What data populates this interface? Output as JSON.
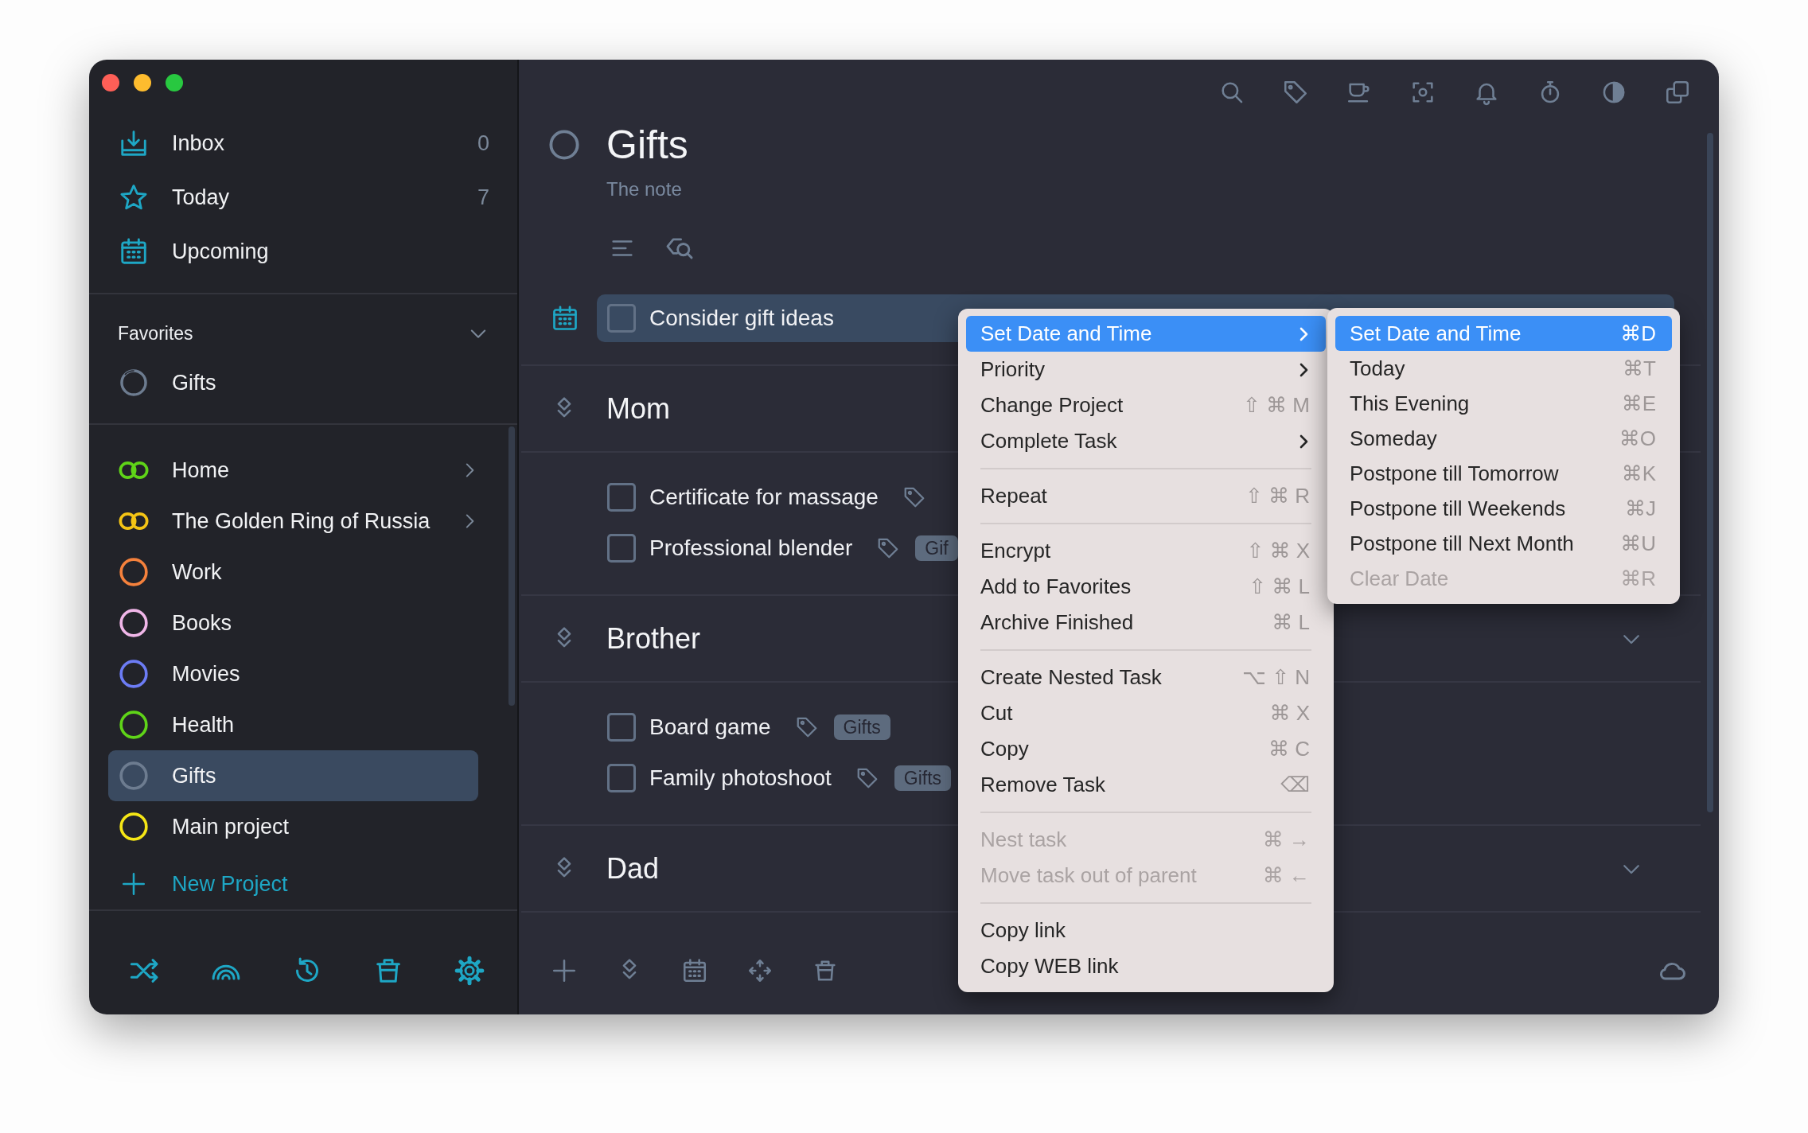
{
  "sidebar": {
    "nav": [
      {
        "kind": "inbox",
        "label": "Inbox",
        "count": "0"
      },
      {
        "kind": "today",
        "label": "Today",
        "count": "7"
      },
      {
        "kind": "upcoming",
        "label": "Upcoming"
      }
    ],
    "favorites": {
      "title": "Favorites",
      "expanded": true,
      "items": [
        {
          "label": "Gifts"
        }
      ]
    },
    "projects": [
      {
        "kind": "area",
        "label": "Home",
        "color": "#5fd418",
        "selected": false
      },
      {
        "kind": "area",
        "label": "The Golden Ring of Russia",
        "color": "#f4c415",
        "selected": false
      },
      {
        "kind": "project",
        "label": "Work",
        "color": "#f5813c",
        "selected": false
      },
      {
        "kind": "project",
        "label": "Books",
        "color": "#f0b6e8",
        "selected": false
      },
      {
        "kind": "project",
        "label": "Movies",
        "color": "#6c7cf5",
        "selected": false
      },
      {
        "kind": "project",
        "label": "Health",
        "color": "#5fd418",
        "selected": false
      },
      {
        "kind": "project",
        "label": "Gifts",
        "color": "#6d7c90",
        "selected": true
      },
      {
        "kind": "project",
        "label": "Main project",
        "color": "#f5e616",
        "selected": false
      }
    ],
    "new_project": "New Project"
  },
  "project": {
    "title": "Gifts",
    "note": "The note"
  },
  "tasks": [
    {
      "title": "Consider gift ideas",
      "checked": false,
      "selected": true,
      "tag_icon": false
    }
  ],
  "sections": [
    {
      "title": "Mom",
      "tasks": [
        {
          "title": "Certificate for massage",
          "checked": false,
          "tag_icon": true
        },
        {
          "title": "Professional blender",
          "checked": false,
          "tag_icon": true,
          "tag": "Gif"
        }
      ]
    },
    {
      "title": "Brother",
      "expanded": true,
      "tasks": [
        {
          "title": "Board game",
          "checked": false,
          "tag_icon": true,
          "tag": "Gifts"
        },
        {
          "title": "Family photoshoot",
          "checked": false,
          "tag_icon": true,
          "tag": "Gifts"
        }
      ]
    },
    {
      "title": "Dad",
      "expanded": true
    }
  ],
  "context_menu": {
    "groups": [
      [
        {
          "label": "Set Date and Time",
          "submenu": true,
          "selected": true,
          "disabled": false
        },
        {
          "label": "Priority",
          "submenu": true,
          "selected": false,
          "disabled": false
        },
        {
          "label": "Change Project",
          "shortcut": "⇧ ⌘ M",
          "submenu": false,
          "selected": false,
          "disabled": false
        },
        {
          "label": "Complete Task",
          "submenu": true,
          "selected": false,
          "disabled": false
        }
      ],
      [
        {
          "label": "Repeat",
          "shortcut": "⇧ ⌘ R",
          "submenu": false,
          "selected": false,
          "disabled": false
        }
      ],
      [
        {
          "label": "Encrypt",
          "shortcut": "⇧ ⌘ X",
          "submenu": false,
          "selected": false,
          "disabled": false
        },
        {
          "label": "Add to Favorites",
          "shortcut": "⇧ ⌘ L",
          "submenu": false,
          "selected": false,
          "disabled": false
        },
        {
          "label": "Archive Finished",
          "shortcut": "⌘ L",
          "submenu": false,
          "selected": false,
          "disabled": false
        }
      ],
      [
        {
          "label": "Create Nested Task",
          "shortcut": "⌥ ⇧ N",
          "submenu": false,
          "selected": false,
          "disabled": false
        },
        {
          "label": "Cut",
          "shortcut": "⌘ X",
          "submenu": false,
          "selected": false,
          "disabled": false
        },
        {
          "label": "Copy",
          "shortcut": "⌘ C",
          "submenu": false,
          "selected": false,
          "disabled": false
        },
        {
          "label": "Remove Task",
          "shortcut": "⌫",
          "submenu": false,
          "selected": false,
          "disabled": false
        }
      ],
      [
        {
          "label": "Nest task",
          "shortcut": "⌘ →",
          "submenu": false,
          "selected": false,
          "disabled": true
        },
        {
          "label": "Move task out of parent",
          "shortcut": "⌘ ←",
          "submenu": false,
          "selected": false,
          "disabled": true
        }
      ],
      [
        {
          "label": "Copy link",
          "submenu": false,
          "selected": false,
          "disabled": false
        },
        {
          "label": "Copy WEB link",
          "submenu": false,
          "selected": false,
          "disabled": false
        }
      ]
    ]
  },
  "submenu": {
    "items": [
      {
        "label": "Set Date and Time",
        "shortcut": "⌘D",
        "selected": true,
        "disabled": false
      },
      {
        "label": "Today",
        "shortcut": "⌘T",
        "selected": false,
        "disabled": false
      },
      {
        "label": "This Evening",
        "shortcut": "⌘E",
        "selected": false,
        "disabled": false
      },
      {
        "label": "Someday",
        "shortcut": "⌘O",
        "selected": false,
        "disabled": false
      },
      {
        "label": "Postpone till Tomorrow",
        "shortcut": "⌘K",
        "selected": false,
        "disabled": false
      },
      {
        "label": "Postpone till Weekends",
        "shortcut": "⌘J",
        "selected": false,
        "disabled": false
      },
      {
        "label": "Postpone till Next Month",
        "shortcut": "⌘U",
        "selected": false,
        "disabled": false
      },
      {
        "label": "Clear Date",
        "shortcut": "⌘R",
        "selected": false,
        "disabled": true
      }
    ]
  }
}
